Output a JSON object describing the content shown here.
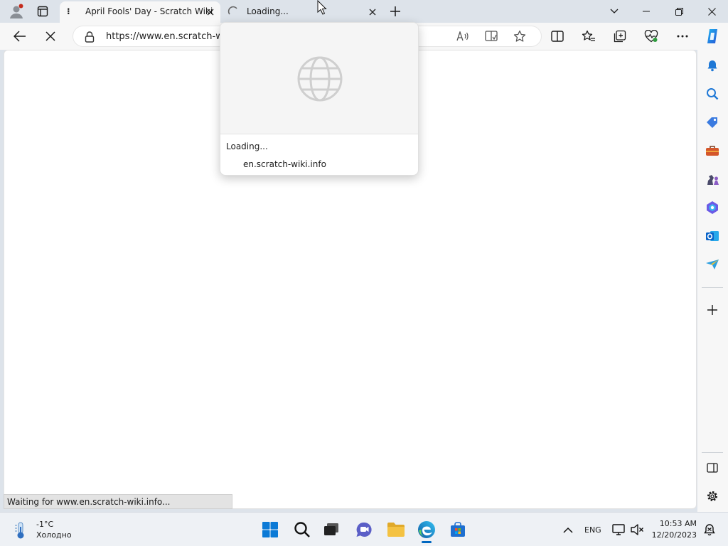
{
  "tabs": [
    {
      "title": "April Fools' Day - Scratch Wiki",
      "active": true
    },
    {
      "title": "Loading...",
      "active": false
    }
  ],
  "address_bar": {
    "url": "https://www.en.scratch-wi"
  },
  "tab_preview": {
    "status": "Loading...",
    "domain": "en.scratch-wiki.info"
  },
  "status_bar": {
    "text": "Waiting for www.en.scratch-wiki.info..."
  },
  "taskbar": {
    "weather_temp": "-1°C",
    "weather_desc": "Холодно",
    "language": "ENG",
    "time": "10:53 AM",
    "date": "12/20/2023"
  },
  "icons": {
    "profile": "profile-icon",
    "tab_actions": "tab-actions-icon",
    "new_tab": "plus-icon",
    "back": "back-arrow-icon",
    "stop": "stop-loading-icon",
    "site_info": "lock-icon",
    "read_aloud": "read-aloud-icon",
    "immersive_reader": "immersive-reader-icon",
    "favorite": "star-icon",
    "split_screen": "split-screen-icon",
    "favorites": "favorites-icon",
    "collections": "collections-icon",
    "essentials": "heartbeat-icon",
    "more": "more-icon",
    "copilot": "copilot-icon"
  },
  "colors": {
    "frame": "#dde3ea",
    "toolbar": "#f7f7f7",
    "accent": "#0067c0",
    "outlook": "#0a64c8",
    "edge": "#0c8de0",
    "folder": "#f4c242"
  }
}
